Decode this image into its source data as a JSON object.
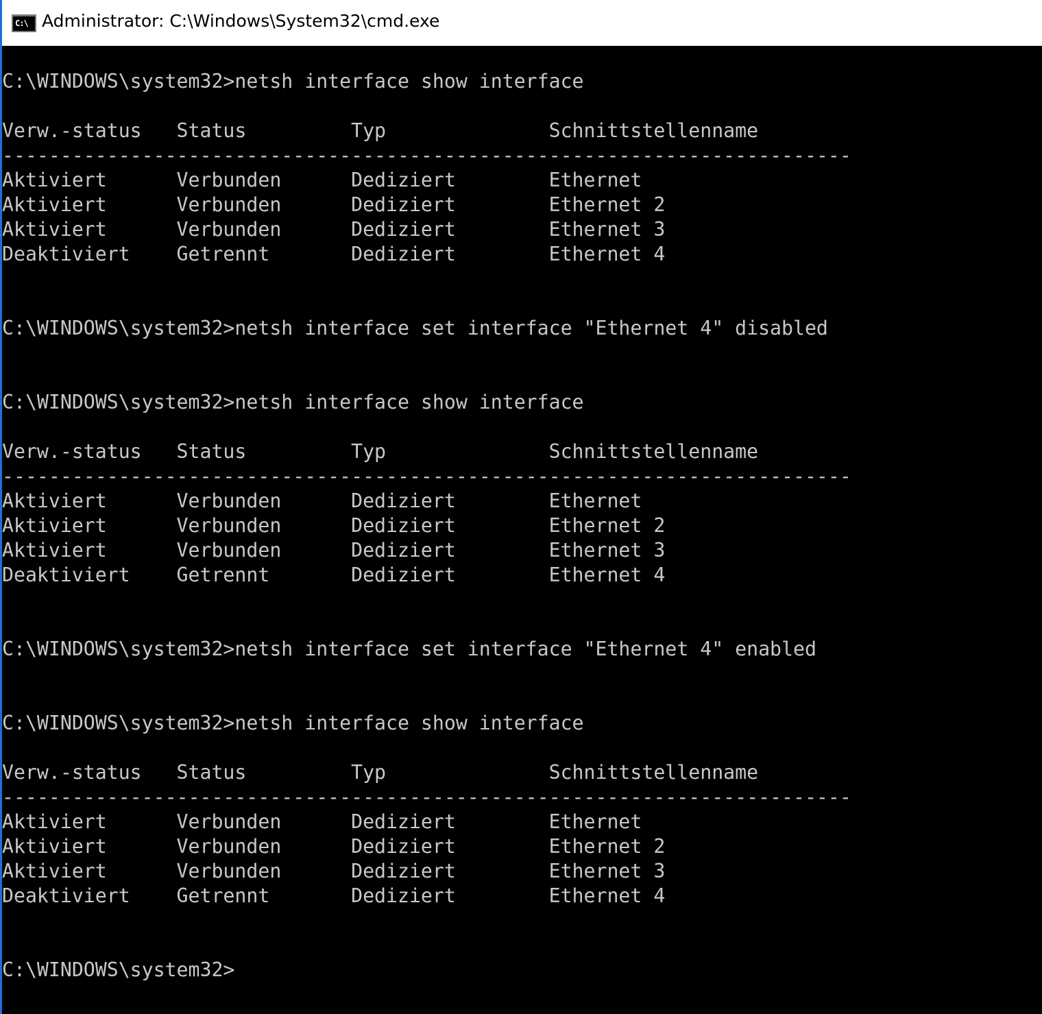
{
  "window": {
    "title": "Administrator: C:\\Windows\\System32\\cmd.exe",
    "icon": "cmd-icon",
    "icon_text": "C:\\",
    "colors": {
      "console_background": "#000000",
      "console_text": "#c8c8c8",
      "titlebar_background": "#ffffff",
      "window_border": "#1e6fd9"
    }
  },
  "console": {
    "lines": [
      "C:\\WINDOWS\\system32>netsh interface show interface",
      "",
      "Verw.-status   Status         Typ              Schnittstellenname",
      "-------------------------------------------------------------------------",
      "Aktiviert      Verbunden      Dediziert        Ethernet",
      "Aktiviert      Verbunden      Dediziert        Ethernet 2",
      "Aktiviert      Verbunden      Dediziert        Ethernet 3",
      "Deaktiviert    Getrennt       Dediziert        Ethernet 4",
      "",
      "",
      "C:\\WINDOWS\\system32>netsh interface set interface \"Ethernet 4\" disabled",
      "",
      "",
      "C:\\WINDOWS\\system32>netsh interface show interface",
      "",
      "Verw.-status   Status         Typ              Schnittstellenname",
      "-------------------------------------------------------------------------",
      "Aktiviert      Verbunden      Dediziert        Ethernet",
      "Aktiviert      Verbunden      Dediziert        Ethernet 2",
      "Aktiviert      Verbunden      Dediziert        Ethernet 3",
      "Deaktiviert    Getrennt       Dediziert        Ethernet 4",
      "",
      "",
      "C:\\WINDOWS\\system32>netsh interface set interface \"Ethernet 4\" enabled",
      "",
      "",
      "C:\\WINDOWS\\system32>netsh interface show interface",
      "",
      "Verw.-status   Status         Typ              Schnittstellenname",
      "-------------------------------------------------------------------------",
      "Aktiviert      Verbunden      Dediziert        Ethernet",
      "Aktiviert      Verbunden      Dediziert        Ethernet 2",
      "Aktiviert      Verbunden      Dediziert        Ethernet 3",
      "Deaktiviert    Getrennt       Dediziert        Ethernet 4",
      "",
      "",
      "C:\\WINDOWS\\system32>"
    ]
  }
}
